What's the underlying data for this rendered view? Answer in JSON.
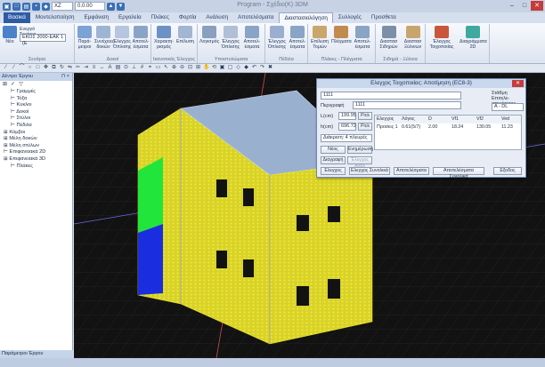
{
  "app": {
    "title": "Program - Σχέδιο(Κ) 3DM",
    "zoom_value": "0.0.00",
    "layer_value": "XZ"
  },
  "tabs": [
    "Βασικά",
    "Μοντελοποίηση",
    "Εμφάνιση",
    "Εργαλεία",
    "Πλάκες",
    "Φορτία",
    "Ανάλυση",
    "Αποτελέσματα",
    "Διαστασιολόγηση",
    "Συλλογές",
    "Προσθετα"
  ],
  "ribbon": {
    "groups": [
      {
        "label": "Σενάρια",
        "buttons": [
          "Νέο",
          "Ενεργό Σενάριο"
        ],
        "select": "ΕΚΟΣ 2000-ΕΑΚ 1 (Ε"
      },
      {
        "label": "Δοκοί",
        "buttons": [
          "Παρά-μετροι",
          "Συνέχειες δοκών",
          "Έλεγχος Όπλισης",
          "Αποτελ-έσματα"
        ]
      },
      {
        "label": "Ικανοτικός Έλεγχος",
        "buttons": [
          "Χαρακτη-ρισμός",
          "Επίλυση"
        ]
      },
      {
        "label": "Υποστυλώματα",
        "buttons": [
          "Λογισμός",
          "Έλεγχος Όπλισης",
          "Αποτελ-έσματα"
        ]
      },
      {
        "label": "Πέδιλα",
        "buttons": [
          "Έλεγχος Όπλισης",
          "Αποτελ-έσματα"
        ]
      },
      {
        "label": "Πλάκες - Πλέγματα",
        "buttons": [
          "Επίλυση Τομών",
          "Πλέγματα",
          "Αποτελ-έσματα"
        ]
      },
      {
        "label": "Σιδηρά - Ξύλινα",
        "buttons": [
          "Διαστασ Σιδηρών",
          "Διαστασ Ξύλινων"
        ]
      },
      {
        "label": "",
        "buttons": [
          "Έλεγχος Τοιχοποιίας",
          "Διαγράμματα 2D"
        ]
      }
    ]
  },
  "panel": {
    "title": "Δέντρο Έργου",
    "footer": "Παράμετροι Έργου",
    "items": [
      {
        "label": "Γραμμές",
        "level": 1
      },
      {
        "label": "Τόξα",
        "level": 1
      },
      {
        "label": "Κύκλοι",
        "level": 1
      },
      {
        "label": "Δοκοί",
        "level": 1
      },
      {
        "label": "Στύλοι",
        "level": 1
      },
      {
        "label": "Πέδιλα",
        "level": 1
      },
      {
        "label": "Κόμβοι",
        "level": 0
      },
      {
        "label": "Μέλη δοκών",
        "level": 0
      },
      {
        "label": "Μέλη στύλων",
        "level": 0
      },
      {
        "label": "Επιφανειακά 2D",
        "level": 0
      },
      {
        "label": "Επιφανειακά 3D",
        "level": 0
      },
      {
        "label": "Πλάκες",
        "level": 1
      }
    ]
  },
  "dialog": {
    "title": "Ελεγχος Τοιχοποιίας: Αποτίμηση (EC8-3)",
    "combo": "1111",
    "desc_label": "Περιγραφή",
    "desc_value": "1111",
    "lcm_label": "L(cm)",
    "lcm_value": "199.95",
    "hcm_label": "h(cm)",
    "hcm_value": "696.72",
    "pick": "Pick",
    "division": "Διάκριση: 4 πλευρές",
    "new_btn": "Νέος",
    "update_btn": "Ενημέρωση",
    "delete_btn": "Διαγραφή",
    "check_all_btn": "Έλεγχος Ανάλ",
    "level_label": "Στάθμη Επιτελε-σπικότητας",
    "level_value": "A - DL",
    "columns": [
      "Ελεγχος",
      "Λόγος",
      "D",
      "Vf1",
      "Vf2",
      "Ved"
    ],
    "rows": [
      [
        "Προσεις 1",
        "0.61(5/7)",
        "2.00",
        "18.24",
        "130.05",
        "11.23"
      ]
    ],
    "buttons": [
      "Ελεγχος",
      "Ελεγχος Συνολικά",
      "Αποτελέσματα",
      "Αποτελέσματα Συνολικά",
      "Εξοδος"
    ]
  },
  "colors": {
    "accent": "#2d5ba4",
    "wall": "#f2ec34",
    "roof": "#8fa7c6",
    "slab_green": "#22e53c",
    "slab_blue": "#1a2ee0",
    "axis_blue": "#6a6ae8",
    "axis_red": "#d24a4a"
  }
}
